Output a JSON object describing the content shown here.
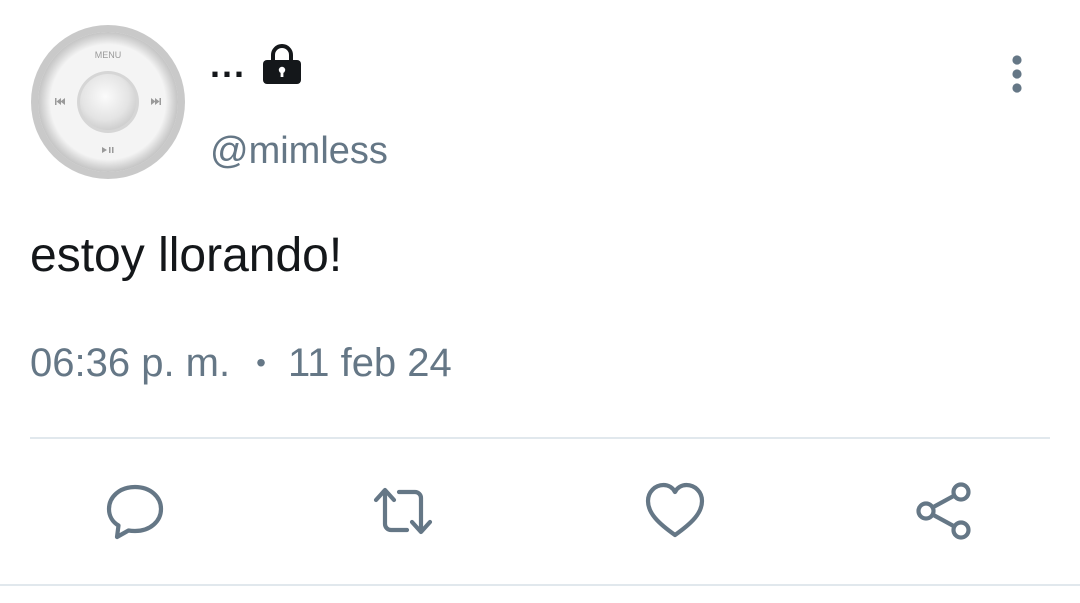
{
  "tweet": {
    "avatar": {
      "menu_label": "MENU",
      "prev_icon": "rewind-icon",
      "next_icon": "fast-forward-icon",
      "play_icon": "play-pause-icon"
    },
    "display_name": "...",
    "protected_icon": "lock-icon",
    "handle": "@mimless",
    "more_icon": "more-vertical-icon",
    "text": "estoy llorando!",
    "time": "06:36 p. m.",
    "separator": "•",
    "date": "11 feb 24",
    "actions": [
      {
        "name": "reply",
        "icon": "comment-icon"
      },
      {
        "name": "retweet",
        "icon": "retweet-icon"
      },
      {
        "name": "like",
        "icon": "heart-icon"
      },
      {
        "name": "share",
        "icon": "share-icon"
      }
    ]
  },
  "colors": {
    "text_primary": "#14171a",
    "text_secondary": "#657786",
    "divider": "#e1e8ed",
    "background": "#ffffff"
  }
}
